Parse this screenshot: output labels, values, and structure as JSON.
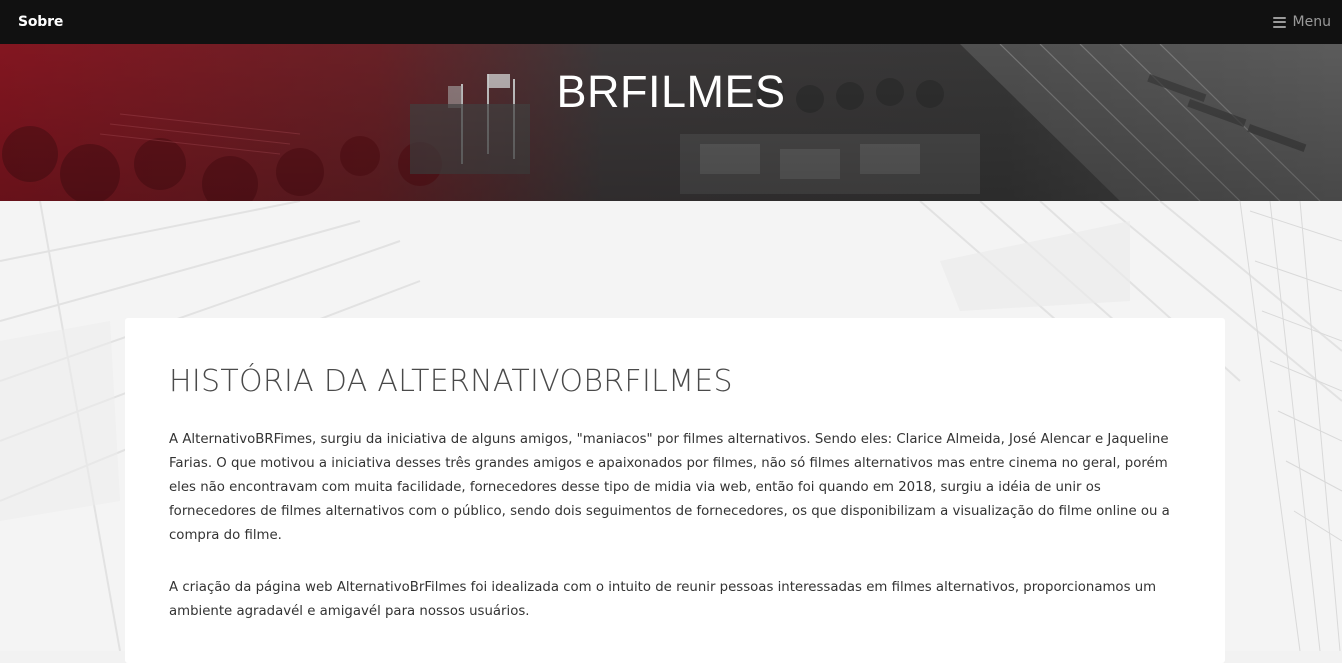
{
  "navbar": {
    "brand": "Sobre",
    "menu_label": "Menu",
    "menu_icon": "hamburger-icon"
  },
  "hero": {
    "title": "BRFILMES"
  },
  "content": {
    "heading": "HISTÓRIA DA ALTERNATIVOBRFILMES",
    "paragraphs": [
      "A AlternativoBRFimes, surgiu da iniciativa de alguns amigos, \"maniacos\" por filmes alternativos. Sendo eles: Clarice Almeida, José Alencar e Jaqueline Farias. O que motivou a iniciativa desses três grandes amigos e apaixonados por filmes, não só filmes alternativos mas entre cinema no geral, porém eles não encontravam com muita facilidade, fornecedores desse tipo de midia via web, então foi quando em 2018, surgiu a idéia de unir os fornecedores de filmes alternativos com o público, sendo dois seguimentos de fornecedores, os que disponibilizam a visualização do filme online ou a compra do filme.",
      "A criação da página web AlternativoBrFilmes foi idealizada com o intuito de reunir pessoas interessadas em filmes alternativos, proporcionamos um ambiente agradavél e amigavél para nossos usuários."
    ]
  },
  "colors": {
    "navbar_bg": "#111111",
    "hero_red": "#8b1a24",
    "hero_gray": "#3a3a3a",
    "card_bg": "#ffffff",
    "page_bg": "#f3f3f3"
  }
}
